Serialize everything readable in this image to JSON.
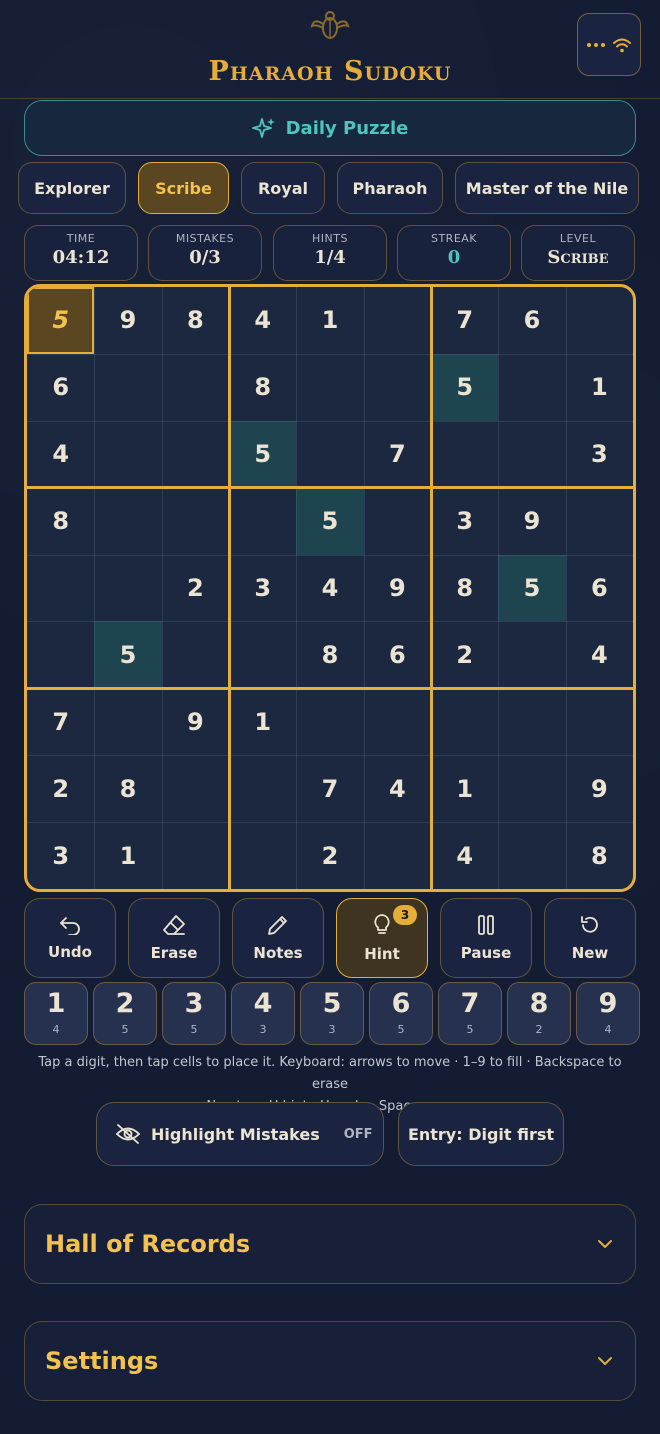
{
  "app": {
    "title": "Pharaoh Sudoku"
  },
  "daily_puzzle": {
    "label": "Daily Puzzle"
  },
  "difficulties": [
    {
      "label": "Explorer",
      "active": false
    },
    {
      "label": "Scribe",
      "active": true
    },
    {
      "label": "Royal",
      "active": false
    },
    {
      "label": "Pharaoh",
      "active": false
    },
    {
      "label": "Master of the Nile",
      "active": false
    }
  ],
  "stats": [
    {
      "label": "TIME",
      "value": "04:12"
    },
    {
      "label": "MISTAKES",
      "value": "0/3"
    },
    {
      "label": "HINTS",
      "value": "1/4"
    },
    {
      "label": "STREAK",
      "value": "0"
    },
    {
      "label": "LEVEL",
      "value": "Scribe"
    }
  ],
  "board": {
    "rows": [
      [
        "5",
        "9",
        "8",
        "4",
        "1",
        "",
        "7",
        "6",
        ""
      ],
      [
        "6",
        "",
        "",
        "8",
        "",
        "",
        "5",
        "",
        "1"
      ],
      [
        "4",
        "",
        "",
        "5",
        "",
        "7",
        "",
        "",
        "3"
      ],
      [
        "8",
        "",
        "",
        "",
        "5",
        "",
        "3",
        "9",
        ""
      ],
      [
        "",
        "",
        "2",
        "3",
        "4",
        "9",
        "8",
        "5",
        "6"
      ],
      [
        "",
        "5",
        "",
        "",
        "8",
        "6",
        "2",
        "",
        "4"
      ],
      [
        "7",
        "",
        "9",
        "1",
        "",
        "",
        "",
        "",
        ""
      ],
      [
        "2",
        "8",
        "",
        "",
        "7",
        "4",
        "1",
        "",
        "9"
      ],
      [
        "3",
        "1",
        "",
        "",
        "2",
        "",
        "4",
        "",
        "8"
      ]
    ],
    "selected_cell": [
      0,
      0
    ],
    "highlighted_digit": "5"
  },
  "actions": [
    {
      "label": "Undo",
      "icon": "undo-icon"
    },
    {
      "label": "Erase",
      "icon": "eraser-icon"
    },
    {
      "label": "Notes",
      "icon": "pencil-icon"
    },
    {
      "label": "Hint",
      "icon": "lightbulb-icon",
      "badge": "3"
    },
    {
      "label": "Pause",
      "icon": "pause-icon"
    },
    {
      "label": "New",
      "icon": "refresh-icon"
    }
  ],
  "digits": [
    {
      "digit": "1",
      "remaining": "4"
    },
    {
      "digit": "2",
      "remaining": "5"
    },
    {
      "digit": "3",
      "remaining": "5"
    },
    {
      "digit": "4",
      "remaining": "3"
    },
    {
      "digit": "5",
      "remaining": "3"
    },
    {
      "digit": "6",
      "remaining": "5"
    },
    {
      "digit": "7",
      "remaining": "5"
    },
    {
      "digit": "8",
      "remaining": "2"
    },
    {
      "digit": "9",
      "remaining": "4"
    }
  ],
  "help": {
    "line1": "Tap a digit, then tap cells to place it. Keyboard: arrows to move · 1–9 to fill · Backspace to erase",
    "line2": "· N notes · H hint · U undo · Space pause"
  },
  "toggles": {
    "highlight_mistakes_label": "Highlight Mistakes",
    "highlight_mistakes_state": "OFF",
    "entry_mode_label": "Entry: Digit first"
  },
  "sections": {
    "records": "Hall of Records",
    "settings": "Settings"
  },
  "colors": {
    "background": "#131c33",
    "gold": "#e5ad3a",
    "teal": "#4ec4c0",
    "highlight": "#1e4450"
  }
}
